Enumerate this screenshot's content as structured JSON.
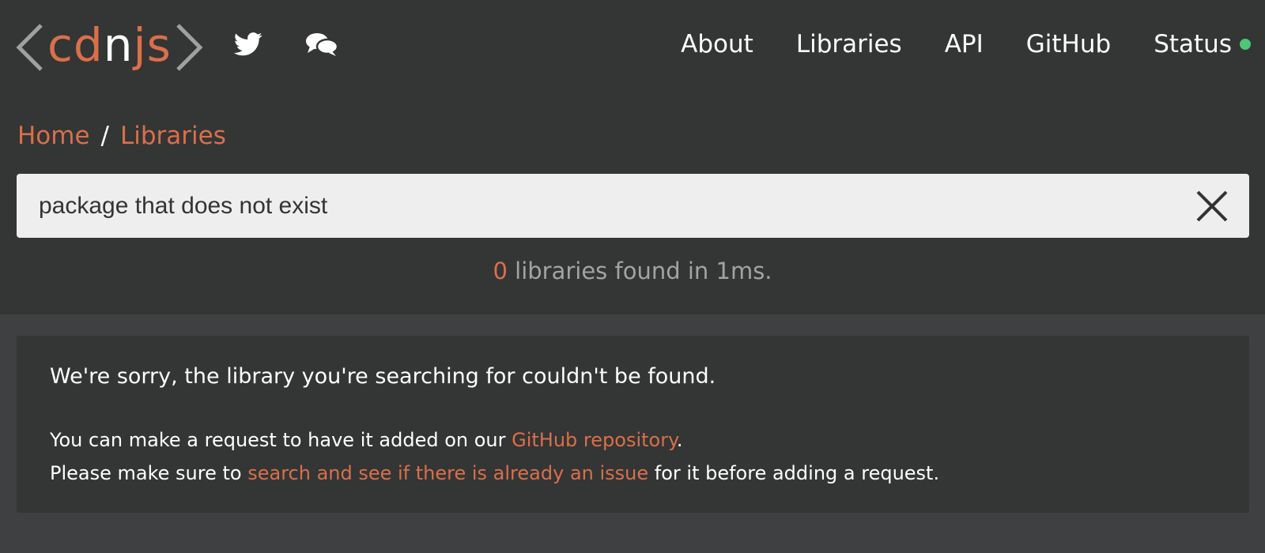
{
  "colors": {
    "accent": "#d9704a",
    "bracket": "#a0a0a0",
    "status_ok": "#4cc777",
    "muted": "#a3a3a3"
  },
  "header": {
    "logo": {
      "left": "c",
      "mid1": "d",
      "mid2": "n",
      "right": "js"
    },
    "icons": [
      "twitter-icon",
      "chat-icon"
    ],
    "nav": {
      "about": "About",
      "libraries": "Libraries",
      "api": "API",
      "github": "GitHub",
      "status": "Status"
    }
  },
  "breadcrumb": {
    "home": "Home",
    "separator": "/",
    "current": "Libraries"
  },
  "search": {
    "value": "package that does not exist",
    "clear_icon": "close-icon"
  },
  "results": {
    "count": "0",
    "text": " libraries found in 1ms."
  },
  "notice": {
    "title": "We're sorry, the library you're searching for couldn't be found.",
    "line1_pre": "You can make a request to have it added on our ",
    "line1_link": "GitHub repository",
    "line1_post": ".",
    "line2_pre": "Please make sure to ",
    "line2_link": "search and see if there is already an issue",
    "line2_post": " for it before adding a request."
  }
}
